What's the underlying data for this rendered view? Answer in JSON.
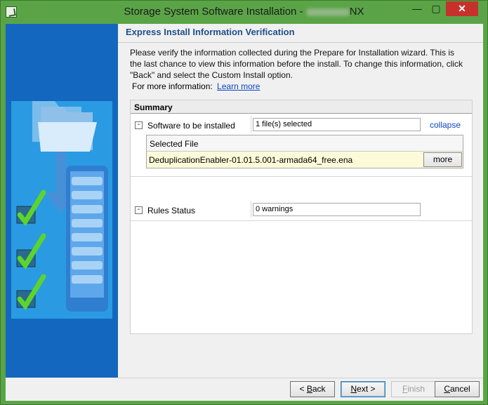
{
  "window": {
    "title_prefix": "Storage System Software Installation - ",
    "title_suffix": "NX",
    "minimize": "—",
    "maximize": "▢",
    "close": "✕"
  },
  "page": {
    "heading": "Express Install Information Verification",
    "description": "Please verify the information collected during the Prepare for Installation wizard. This is the last chance to view this information before the install. To change this information, click \"Back\" and select the Custom Install option.",
    "more_info_label": "For more information:",
    "learn_more": "Learn more"
  },
  "summary": {
    "title": "Summary",
    "software": {
      "toggle": "-",
      "label": "Software to be installed",
      "value": "1 file(s) selected",
      "collapse": "collapse",
      "file_header": "Selected File",
      "file_name": "DeduplicationEnabler-01.01.5.001-armada64_free.ena",
      "more": "more"
    },
    "rules": {
      "toggle": "-",
      "label": "Rules Status",
      "value": "0 warnings"
    }
  },
  "buttons": {
    "back_pre": "< ",
    "back_u": "B",
    "back_post": "ack",
    "next_u": "N",
    "next_post": "ext >",
    "finish_u": "F",
    "finish_post": "inish",
    "cancel_pre": "",
    "cancel_u": "C",
    "cancel_post": "ancel"
  },
  "colors": {
    "titlebar": "#5aa447",
    "side_panel": "#1367bf",
    "heading": "#1f4f8b",
    "link": "#0b46c5",
    "selected_row": "#fcfbd9",
    "close_button": "#c7312b"
  }
}
